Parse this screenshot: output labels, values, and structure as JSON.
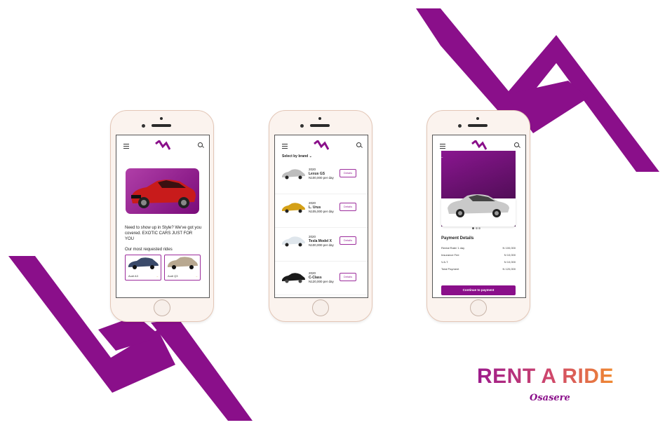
{
  "colors": {
    "accent": "#8a0f8a",
    "brand_gradient_start": "#9c1a8c",
    "brand_gradient_end": "#f08a30"
  },
  "phone1": {
    "hero_text": "Need to show up in Style? We've got you covered. EXOTIC CARS JUST FOR YOU",
    "section_title": "Our most requested rides",
    "cards": [
      {
        "label": "Audi A3"
      },
      {
        "label": "Audi Q3"
      }
    ]
  },
  "phone2": {
    "select_brand": "Select by brand",
    "cars": [
      {
        "year": "2020",
        "name": "Lexus GS",
        "price": "N100,000 per day",
        "button": "Details"
      },
      {
        "year": "2020",
        "name": "L. Urus",
        "price": "N105,000 per day",
        "button": "Details"
      },
      {
        "year": "2020",
        "name": "Tesla Model X",
        "price": "N100,000 per day",
        "button": "Details"
      },
      {
        "year": "2020",
        "name": "C-Class",
        "price": "N120,000 per day",
        "button": "Details"
      }
    ]
  },
  "phone3": {
    "payment_title": "Payment Details",
    "rows": [
      {
        "label": "Rental Rate/ 1 day",
        "value": "N 100,000"
      },
      {
        "label": "Insurance Fee",
        "value": "N 10,000"
      },
      {
        "label": "V.A.T.",
        "value": "N 10,000"
      },
      {
        "label": "Total Payment",
        "value": "N 120,000"
      }
    ],
    "cta": "Continue to payment"
  },
  "brand": {
    "title": "RENT A RIDE",
    "author": "Osasere"
  }
}
